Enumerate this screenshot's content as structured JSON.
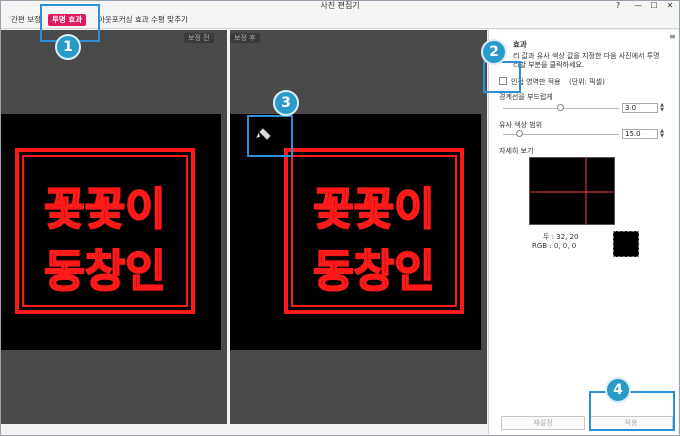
{
  "window": {
    "title": "사진 편집기",
    "help_label": "?",
    "minimize_label": "—",
    "maximize_label": "☐",
    "close_label": "✕"
  },
  "tabs": [
    {
      "label": "간편 보정",
      "active": false
    },
    {
      "label": "투명 효과",
      "active": true
    },
    {
      "label": "아웃포커싱 효과",
      "active": false
    },
    {
      "label": "수평 맞추기",
      "active": false
    }
  ],
  "left_pane": {
    "label": "보정 전"
  },
  "right_pane": {
    "label": "보정 후"
  },
  "stamp": {
    "line1": "꽃꽃이",
    "line2": "동창인",
    "color": "#ff1a1a"
  },
  "side": {
    "menu_icon": "≡",
    "section_title": "효과",
    "description": "리 값과 유사 색상 값을 지정한 다음 사진에서 투명\n리할 부분을 클릭하세요.",
    "checkbox_label": "인접 영역만 적용",
    "unit_label": "(단위: 픽셀)",
    "edge_label": "경계선을 부드럽게",
    "edge_value": "3.0",
    "edge_fraction": 0.5,
    "similar_label": "유사 색상 범위",
    "similar_value": "15.0",
    "similar_fraction": 0.15,
    "detail_label": "자세히 보기",
    "coord_text": "두 : 32, 20",
    "rgb_text": "RGB : 0, 0, 0"
  },
  "buttons": {
    "reset": "재설정",
    "apply": "적용"
  },
  "callouts": [
    "1",
    "2",
    "3",
    "4"
  ],
  "colors": {
    "accent": "#e2185a",
    "callout": "#2a9bc9",
    "callout_border": "#2e8ed6"
  }
}
